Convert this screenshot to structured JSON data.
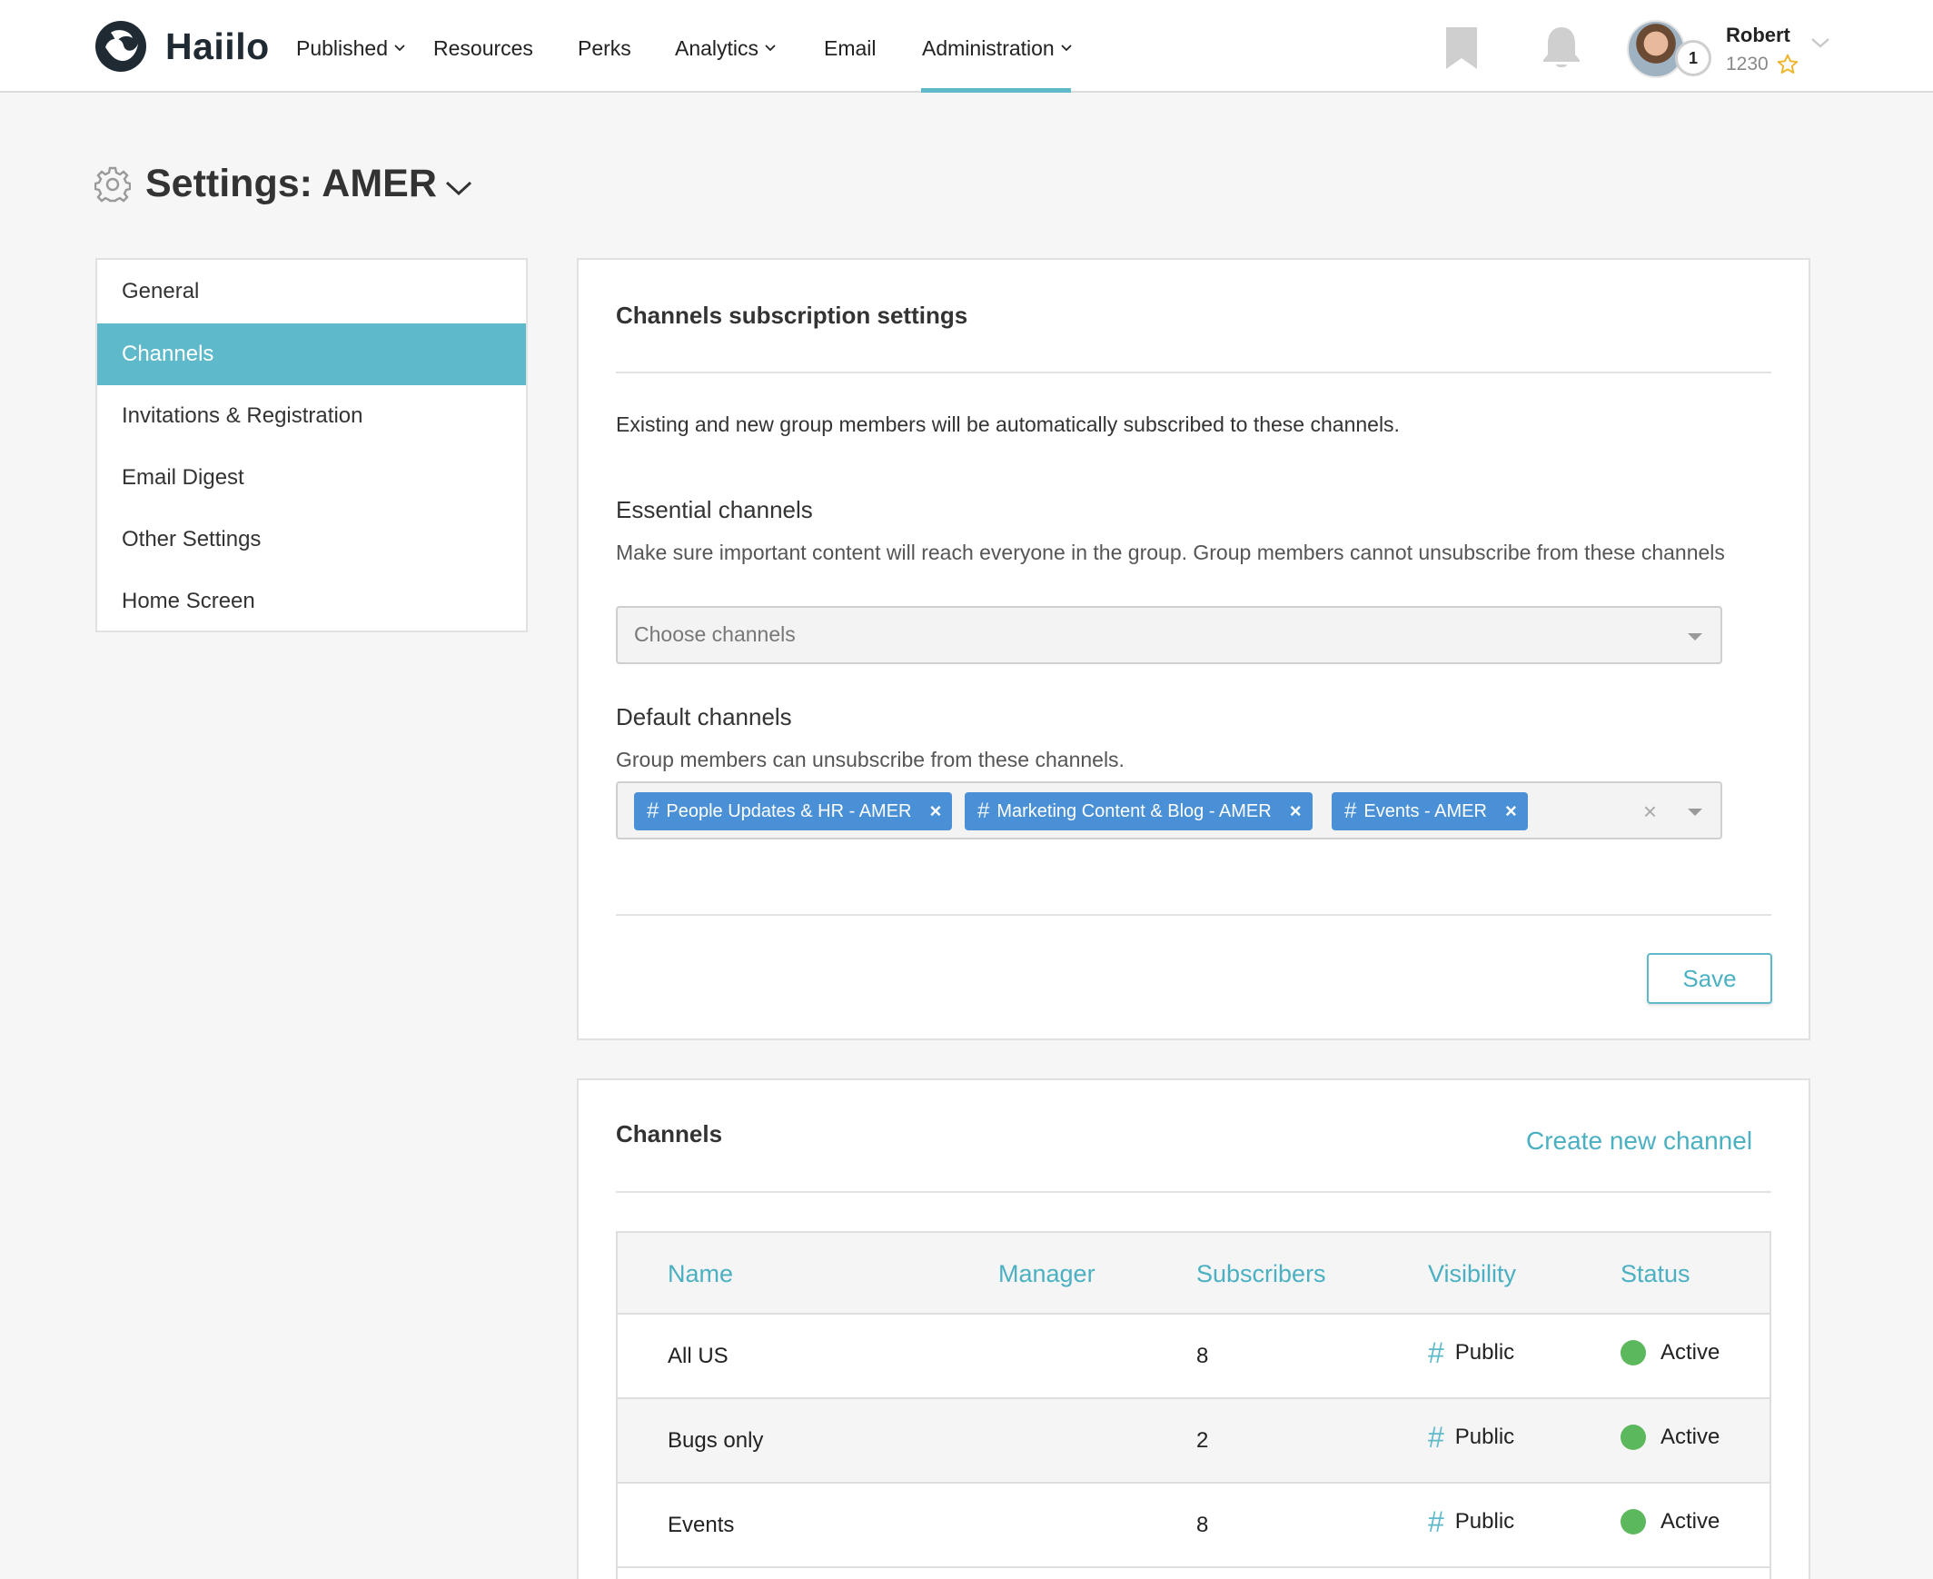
{
  "brand": {
    "name": "Haiilo",
    "accent": "#5ebaca",
    "tag_color": "#4a90d6",
    "active_color": "#5cb85c"
  },
  "nav": {
    "items": [
      {
        "label": "Published",
        "dropdown": true
      },
      {
        "label": "Resources",
        "dropdown": false
      },
      {
        "label": "Perks",
        "dropdown": false
      },
      {
        "label": "Analytics",
        "dropdown": true
      },
      {
        "label": "Email",
        "dropdown": false
      },
      {
        "label": "Administration",
        "dropdown": true,
        "active": true
      }
    ]
  },
  "user": {
    "name": "Robert",
    "points": "1230",
    "level": "1"
  },
  "page": {
    "title": "Settings: AMER"
  },
  "sidebar": {
    "items": [
      {
        "label": "General"
      },
      {
        "label": "Channels",
        "active": true
      },
      {
        "label": "Invitations & Registration"
      },
      {
        "label": "Email Digest"
      },
      {
        "label": "Other Settings"
      },
      {
        "label": "Home Screen"
      }
    ]
  },
  "subscription": {
    "title": "Channels subscription settings",
    "intro": "Existing and new group members will be automatically subscribed to these channels.",
    "essential": {
      "label": "Essential channels",
      "help": "Make sure important content will reach everyone in the group. Group members cannot unsubscribe from these channels",
      "placeholder": "Choose channels"
    },
    "default": {
      "label": "Default channels",
      "help": "Group members can unsubscribe from these channels.",
      "tags": [
        "People Updates & HR - AMER",
        "Marketing Content & Blog - AMER",
        "Events - AMER"
      ]
    },
    "save_label": "Save"
  },
  "channels": {
    "title": "Channels",
    "create_label": "Create new channel",
    "columns": [
      "Name",
      "Manager",
      "Subscribers",
      "Visibility",
      "Status"
    ],
    "rows": [
      {
        "name": "All US",
        "manager": "",
        "subscribers": "8",
        "visibility": "Public",
        "status": "Active"
      },
      {
        "name": "Bugs only",
        "manager": "",
        "subscribers": "2",
        "visibility": "Public",
        "status": "Active"
      },
      {
        "name": "Events",
        "manager": "",
        "subscribers": "8",
        "visibility": "Public",
        "status": "Active"
      }
    ]
  }
}
